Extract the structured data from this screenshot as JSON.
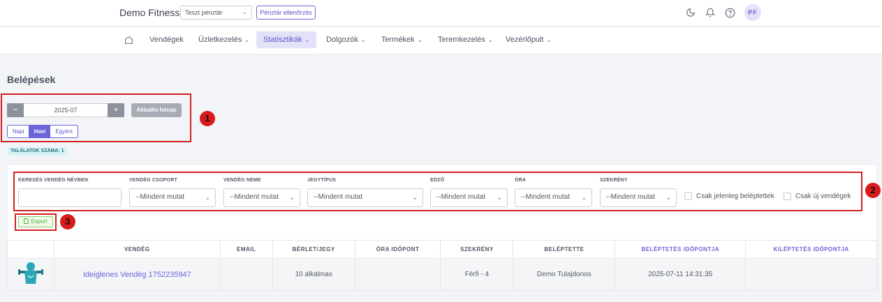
{
  "header": {
    "brand": "Demo Fitness",
    "register_select": "Teszt pénztár",
    "register_check_label": "Pénztár ellenőrzés",
    "icons": [
      "moon-icon",
      "bell-icon",
      "help-icon"
    ],
    "avatar_initials": "PF"
  },
  "nav": {
    "items": [
      {
        "label": "Vendégek",
        "dropdown": false
      },
      {
        "label": "Üzletkezelés",
        "dropdown": true
      },
      {
        "label": "Statisztikák",
        "dropdown": true,
        "active": true
      },
      {
        "label": "Dolgozók",
        "dropdown": true
      },
      {
        "label": "Termékek",
        "dropdown": true
      },
      {
        "label": "Teremkezelés",
        "dropdown": true
      },
      {
        "label": "Vezérlőpult",
        "dropdown": true
      }
    ]
  },
  "page": {
    "title": "Belépések"
  },
  "date_picker": {
    "minus": "−",
    "value": "2025-07",
    "plus": "+",
    "current_month_label": "Aktuális hónap"
  },
  "period": {
    "options": [
      "Napi",
      "Havi",
      "Egyéni"
    ],
    "selected": "Havi"
  },
  "annotations": [
    "1",
    "2",
    "3"
  ],
  "results": {
    "label": "TALÁLATOK SZÁMA: 1"
  },
  "filters": {
    "search_label": "KERESÉS VENDÉG NÉVBEN",
    "search_value": "",
    "group_label": "VENDÉG CSOPORT",
    "group_value": "--Mindent mutat",
    "gender_label": "VENDÉG NEME",
    "gender_value": "--Mindent mutat",
    "ticket_label": "JEGYTÍPUS",
    "ticket_value": "--Mindent mutat",
    "trainer_label": "EDZŐ",
    "trainer_value": "--Mindent mutat",
    "class_label": "ÓRA",
    "class_value": "--Mindent mutat",
    "locker_label": "SZEKRÉNY",
    "locker_value": "--Mindent mutat",
    "only_present_label": "Csak jelenleg beléptettek",
    "only_new_label": "Csak új vendégek"
  },
  "export": {
    "label": "Export"
  },
  "table": {
    "columns": [
      "",
      "VENDÉG",
      "EMAIL",
      "BÉRLET/JEGY",
      "ÓRA IDŐPONT",
      "SZEKRÉNY",
      "BELÉPTETTE",
      "BELÉPTETÉS IDŐPONTJA",
      "KILÉPTETÉS IDŐPONTJA"
    ],
    "rows": [
      {
        "guest": "Ideiglenes Vendég 1752235947",
        "email": "",
        "pass": "10 alkalmas",
        "class_time": "",
        "locker": "Férfi - 4",
        "checked_in_by": "Demo Tulajdonos",
        "check_in_time": "2025-07-11 14:31:35",
        "check_out_time": ""
      }
    ]
  },
  "colors": {
    "accent": "#6a63d9",
    "annotation_red": "#d21f1f",
    "export_green": "#4caf34"
  }
}
